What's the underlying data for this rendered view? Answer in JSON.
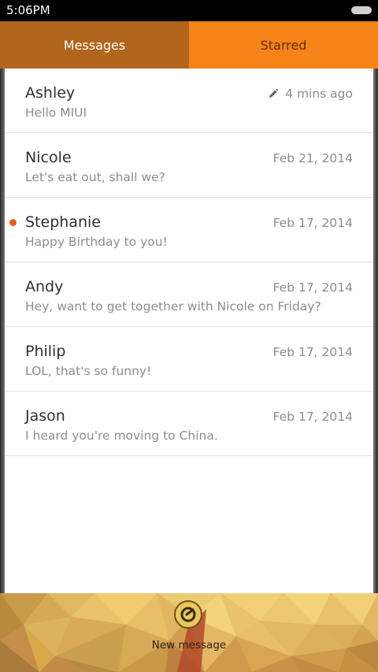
{
  "status_bar": {
    "time": "5:06PM"
  },
  "tabs": [
    {
      "label": "Messages",
      "active": true
    },
    {
      "label": "Starred",
      "active": false
    }
  ],
  "messages": [
    {
      "name": "Ashley",
      "preview": "Hello MIUI",
      "date": "4 mins ago",
      "draft": true,
      "unread": false
    },
    {
      "name": "Nicole",
      "preview": "Let's eat out, shall we?",
      "date": "Feb 21, 2014",
      "draft": false,
      "unread": false
    },
    {
      "name": "Stephanie",
      "preview": "Happy Birthday to you!",
      "date": "Feb 17, 2014",
      "draft": false,
      "unread": true
    },
    {
      "name": "Andy",
      "preview": "Hey, want to get together with Nicole on Friday?",
      "date": "Feb 17, 2014",
      "draft": false,
      "unread": false
    },
    {
      "name": "Philip",
      "preview": "LOL, that's so funny!",
      "date": "Feb 17, 2014",
      "draft": false,
      "unread": false
    },
    {
      "name": "Jason",
      "preview": "I heard you're moving to China.",
      "date": "Feb 17, 2014",
      "draft": false,
      "unread": false
    }
  ],
  "bottom_bar": {
    "new_message_label": "New message",
    "compose_icon": "compose-icon"
  },
  "colors": {
    "tab_active": "#b2651d",
    "tab_inactive": "#f68318",
    "unread_dot": "#f05a1a"
  }
}
